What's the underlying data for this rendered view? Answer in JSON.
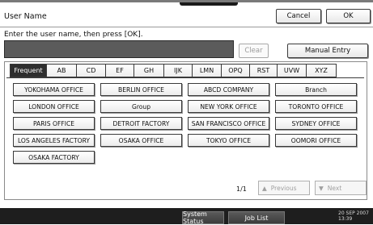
{
  "window": {
    "title": "User Name",
    "cancel_label": "Cancel",
    "ok_label": "OK"
  },
  "entry": {
    "prompt": "Enter the user name, then press [OK].",
    "value": "",
    "clear_label": "Clear",
    "manual_entry_label": "Manual Entry"
  },
  "tabs": [
    "Frequent",
    "AB",
    "CD",
    "EF",
    "GH",
    "IJK",
    "LMN",
    "OPQ",
    "RST",
    "UVW",
    "XYZ"
  ],
  "active_tab": "Frequent",
  "entries": [
    "YOKOHAMA OFFICE",
    "BERLIN OFFICE",
    "ABCD COMPANY",
    "Branch",
    "LONDON OFFICE",
    "Group",
    "NEW YORK OFFICE",
    "TORONTO OFFICE",
    "PARIS OFFICE",
    "DETROIT FACTORY",
    "SAN FRANCISCO OFFICE",
    "SYDNEY OFFICE",
    "LOS ANGELES FACTORY",
    "OSAKA OFFICE",
    "TOKYO OFFICE",
    "OOMORI OFFICE",
    "OSAKA FACTORY"
  ],
  "pagination": {
    "page_indicator": "1/1",
    "previous_label": "Previous",
    "next_label": "Next"
  },
  "statusbar": {
    "system_status_label": "System Status",
    "job_list_label": "Job List",
    "date": "20 SEP 2007",
    "time": "13:39"
  }
}
